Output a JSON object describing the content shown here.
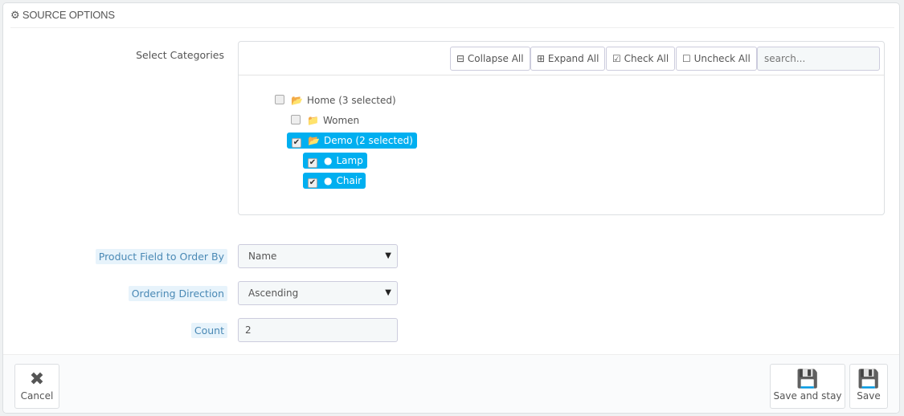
{
  "panel": {
    "title": "SOURCE OPTIONS",
    "icon": "cogs-icon"
  },
  "categories": {
    "label": "Select Categories",
    "toolbar": {
      "collapse": "Collapse All",
      "expand": "Expand All",
      "check": "Check All",
      "uncheck": "Uncheck All",
      "search_placeholder": "search..."
    },
    "nodes": [
      {
        "label": "Home (3 selected)",
        "checked": false
      },
      {
        "label": "Women",
        "checked": false
      },
      {
        "label": "Demo (2 selected)",
        "checked": true
      },
      {
        "label": "Lamp",
        "checked": true
      },
      {
        "label": "Chair",
        "checked": true
      }
    ]
  },
  "fields": {
    "order_by": {
      "label": "Product Field to Order By",
      "value": "Name"
    },
    "direction": {
      "label": "Ordering Direction",
      "value": "Ascending"
    },
    "count": {
      "label": "Count",
      "value": "2"
    }
  },
  "footer": {
    "cancel": "Cancel",
    "save_stay": "Save and stay",
    "save": "Save"
  },
  "colors": {
    "accent": "#00aff0",
    "hint_bg": "#e7f3fb",
    "hint_text": "#4a89b5"
  }
}
